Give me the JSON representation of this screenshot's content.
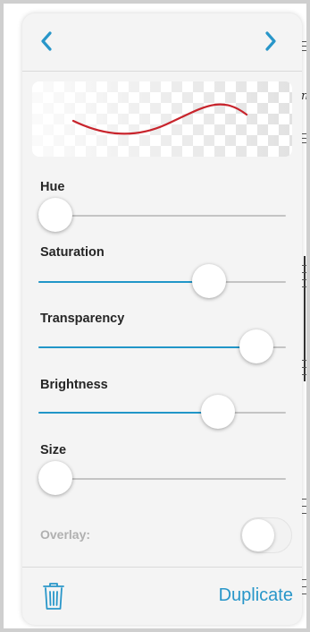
{
  "nav": {
    "back_icon": "chevron-left-icon",
    "forward_icon": "chevron-right-icon"
  },
  "sliders": [
    {
      "label": "Hue",
      "value": 0.0
    },
    {
      "label": "Saturation",
      "value": 0.72
    },
    {
      "label": "Transparency",
      "value": 0.94
    },
    {
      "label": "Brightness",
      "value": 0.76
    },
    {
      "label": "Size",
      "value": 0.0
    }
  ],
  "overlay": {
    "label": "Overlay:",
    "on": false
  },
  "footer": {
    "delete_icon": "trash-icon",
    "duplicate_label": "Duplicate"
  },
  "colors": {
    "accent": "#2896c9",
    "stroke": "#c8242c",
    "track": "#c4c4c4"
  },
  "background_text": {
    "glyph": "n"
  }
}
